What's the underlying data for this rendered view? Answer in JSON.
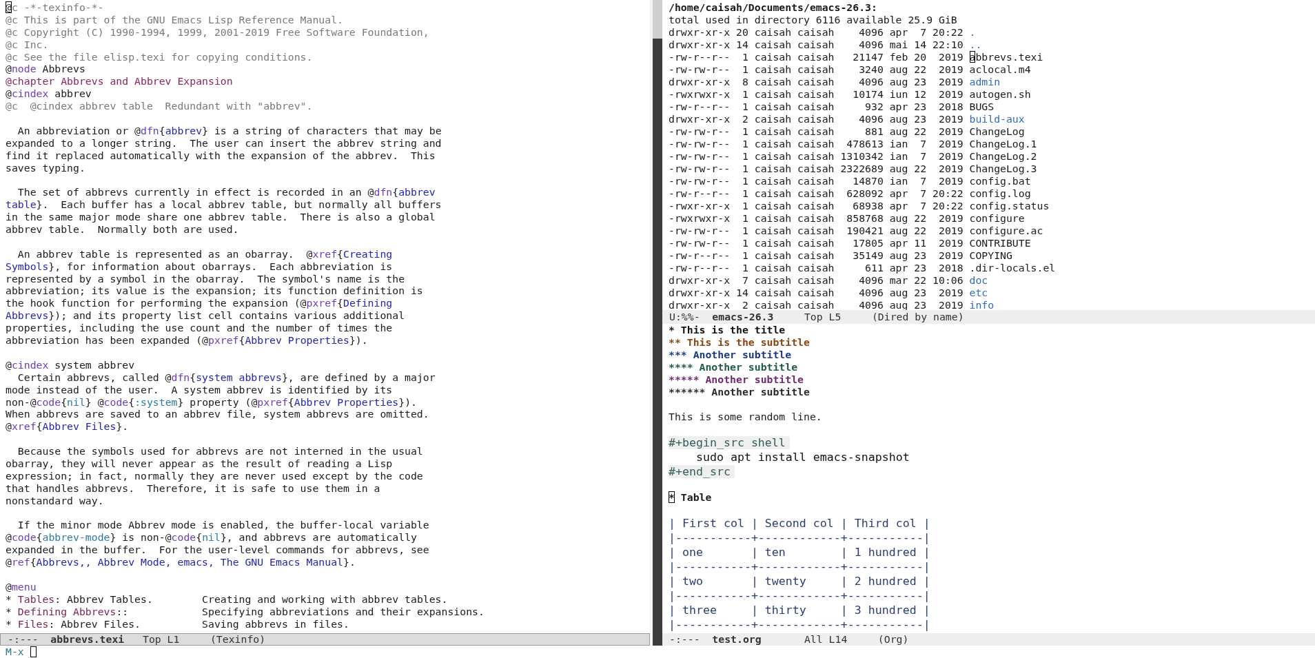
{
  "texinfo_window": {
    "paragraphs": [
      {
        "lines": [
          [
            {
              "kind": "cursor",
              "text": "@"
            },
            {
              "kind": "comment",
              "text": "c -*-texinfo-*-"
            }
          ],
          [
            {
              "kind": "comment",
              "text": "@c This is part of the GNU Emacs Lisp Reference Manual."
            }
          ],
          [
            {
              "kind": "comment",
              "text": "@c Copyright (C) 1990-1994, 1999, 2001-2019 Free Software Foundation,"
            }
          ],
          [
            {
              "kind": "comment",
              "text": "@c Inc."
            }
          ],
          [
            {
              "kind": "comment",
              "text": "@c See the file elisp.texi for copying conditions."
            }
          ],
          [
            {
              "kind": "plain",
              "text": "@"
            },
            {
              "kind": "keyword",
              "text": "node"
            },
            {
              "kind": "plain",
              "text": " Abbrevs"
            }
          ],
          [
            {
              "kind": "chapter",
              "text": "@chapter Abbrevs and Abbrev Expansion"
            }
          ],
          [
            {
              "kind": "plain",
              "text": "@"
            },
            {
              "kind": "keyword",
              "text": "cindex"
            },
            {
              "kind": "plain",
              "text": " abbrev"
            }
          ],
          [
            {
              "kind": "comment",
              "text": "@c  @cindex abbrev table  Redundant with \"abbrev\"."
            }
          ]
        ]
      },
      {
        "lines": [
          [
            {
              "kind": "plain",
              "text": "  An abbreviation or @"
            },
            {
              "kind": "keyword",
              "text": "dfn"
            },
            {
              "kind": "plain",
              "text": "{"
            },
            {
              "kind": "ref",
              "text": "abbrev"
            },
            {
              "kind": "plain",
              "text": "} is a string of characters that may be"
            }
          ],
          [
            {
              "kind": "plain",
              "text": "expanded to a longer string.  The user can insert the abbrev string and"
            }
          ],
          [
            {
              "kind": "plain",
              "text": "find it replaced automatically with the expansion of the abbrev.  This"
            }
          ],
          [
            {
              "kind": "plain",
              "text": "saves typing."
            }
          ]
        ]
      },
      {
        "lines": [
          [
            {
              "kind": "plain",
              "text": "  The set of abbrevs currently in effect is recorded in an @"
            },
            {
              "kind": "keyword",
              "text": "dfn"
            },
            {
              "kind": "plain",
              "text": "{"
            },
            {
              "kind": "ref",
              "text": "abbrev"
            }
          ],
          [
            {
              "kind": "ref",
              "text": "table"
            },
            {
              "kind": "plain",
              "text": "}.  Each buffer has a local abbrev table, but normally all buffers"
            }
          ],
          [
            {
              "kind": "plain",
              "text": "in the same major mode share one abbrev table.  There is also a global"
            }
          ],
          [
            {
              "kind": "plain",
              "text": "abbrev table.  Normally both are used."
            }
          ]
        ]
      },
      {
        "lines": [
          [
            {
              "kind": "plain",
              "text": "  An abbrev table is represented as an obarray.  @"
            },
            {
              "kind": "keyword",
              "text": "xref"
            },
            {
              "kind": "plain",
              "text": "{"
            },
            {
              "kind": "ref",
              "text": "Creating"
            }
          ],
          [
            {
              "kind": "ref",
              "text": "Symbols"
            },
            {
              "kind": "plain",
              "text": "}, for information about obarrays.  Each abbreviation is"
            }
          ],
          [
            {
              "kind": "plain",
              "text": "represented by a symbol in the obarray.  The symbol's name is the"
            }
          ],
          [
            {
              "kind": "plain",
              "text": "abbreviation; its value is the expansion; its function definition is"
            }
          ],
          [
            {
              "kind": "plain",
              "text": "the hook function for performing the expansion (@"
            },
            {
              "kind": "keyword",
              "text": "pxref"
            },
            {
              "kind": "plain",
              "text": "{"
            },
            {
              "kind": "ref",
              "text": "Defining"
            }
          ],
          [
            {
              "kind": "ref",
              "text": "Abbrevs"
            },
            {
              "kind": "plain",
              "text": "}); and its property list cell contains various additional"
            }
          ],
          [
            {
              "kind": "plain",
              "text": "properties, including the use count and the number of times the"
            }
          ],
          [
            {
              "kind": "plain",
              "text": "abbreviation has been expanded (@"
            },
            {
              "kind": "keyword",
              "text": "pxref"
            },
            {
              "kind": "plain",
              "text": "{"
            },
            {
              "kind": "ref",
              "text": "Abbrev Properties"
            },
            {
              "kind": "plain",
              "text": "})."
            }
          ]
        ]
      },
      {
        "lines": [
          [
            {
              "kind": "plain",
              "text": "@"
            },
            {
              "kind": "keyword",
              "text": "cindex"
            },
            {
              "kind": "plain",
              "text": " system abbrev"
            }
          ],
          [
            {
              "kind": "plain",
              "text": "  Certain abbrevs, called @"
            },
            {
              "kind": "keyword",
              "text": "dfn"
            },
            {
              "kind": "plain",
              "text": "{"
            },
            {
              "kind": "ref",
              "text": "system abbrevs"
            },
            {
              "kind": "plain",
              "text": "}, are defined by a major"
            }
          ],
          [
            {
              "kind": "plain",
              "text": "mode instead of the user.  A system abbrev is identified by its"
            }
          ],
          [
            {
              "kind": "plain",
              "text": "non-@"
            },
            {
              "kind": "keyword",
              "text": "code"
            },
            {
              "kind": "plain",
              "text": "{"
            },
            {
              "kind": "code",
              "text": "nil"
            },
            {
              "kind": "plain",
              "text": "} @"
            },
            {
              "kind": "keyword",
              "text": "code"
            },
            {
              "kind": "plain",
              "text": "{"
            },
            {
              "kind": "code",
              "text": ":system"
            },
            {
              "kind": "plain",
              "text": "} property (@"
            },
            {
              "kind": "keyword",
              "text": "pxref"
            },
            {
              "kind": "plain",
              "text": "{"
            },
            {
              "kind": "ref",
              "text": "Abbrev Properties"
            },
            {
              "kind": "plain",
              "text": "})."
            }
          ],
          [
            {
              "kind": "plain",
              "text": "When abbrevs are saved to an abbrev file, system abbrevs are omitted."
            }
          ],
          [
            {
              "kind": "plain",
              "text": "@"
            },
            {
              "kind": "keyword",
              "text": "xref"
            },
            {
              "kind": "plain",
              "text": "{"
            },
            {
              "kind": "ref",
              "text": "Abbrev Files"
            },
            {
              "kind": "plain",
              "text": "}."
            }
          ]
        ]
      },
      {
        "lines": [
          [
            {
              "kind": "plain",
              "text": "  Because the symbols used for abbrevs are not interned in the usual"
            }
          ],
          [
            {
              "kind": "plain",
              "text": "obarray, they will never appear as the result of reading a Lisp"
            }
          ],
          [
            {
              "kind": "plain",
              "text": "expression; in fact, normally they are never used except by the code"
            }
          ],
          [
            {
              "kind": "plain",
              "text": "that handles abbrevs.  Therefore, it is safe to use them in a"
            }
          ],
          [
            {
              "kind": "plain",
              "text": "nonstandard way."
            }
          ]
        ]
      },
      {
        "lines": [
          [
            {
              "kind": "plain",
              "text": "  If the minor mode Abbrev mode is enabled, the buffer-local variable"
            }
          ],
          [
            {
              "kind": "plain",
              "text": "@"
            },
            {
              "kind": "keyword",
              "text": "code"
            },
            {
              "kind": "plain",
              "text": "{"
            },
            {
              "kind": "code",
              "text": "abbrev-mode"
            },
            {
              "kind": "plain",
              "text": "} is non-@"
            },
            {
              "kind": "keyword",
              "text": "code"
            },
            {
              "kind": "plain",
              "text": "{"
            },
            {
              "kind": "code",
              "text": "nil"
            },
            {
              "kind": "plain",
              "text": "}, and abbrevs are automatically"
            }
          ],
          [
            {
              "kind": "plain",
              "text": "expanded in the buffer.  For the user-level commands for abbrevs, see"
            }
          ],
          [
            {
              "kind": "plain",
              "text": "@"
            },
            {
              "kind": "keyword",
              "text": "ref"
            },
            {
              "kind": "plain",
              "text": "{"
            },
            {
              "kind": "ref",
              "text": "Abbrevs,, Abbrev Mode, emacs, The GNU Emacs Manual"
            },
            {
              "kind": "plain",
              "text": "}."
            }
          ]
        ]
      },
      {
        "lines": [
          [
            {
              "kind": "plain",
              "text": "@"
            },
            {
              "kind": "keyword",
              "text": "menu"
            }
          ],
          [
            {
              "kind": "plain",
              "text": "* "
            },
            {
              "kind": "menu",
              "text": "Tables"
            },
            {
              "kind": "plain",
              "text": ": Abbrev Tables.        Creating and working with abbrev tables."
            }
          ],
          [
            {
              "kind": "plain",
              "text": "* "
            },
            {
              "kind": "menu",
              "text": "Defining Abbrevs"
            },
            {
              "kind": "plain",
              "text": "::            Specifying abbreviations and their expansions."
            }
          ],
          [
            {
              "kind": "plain",
              "text": "* "
            },
            {
              "kind": "menu",
              "text": "Files"
            },
            {
              "kind": "plain",
              "text": ": Abbrev Files.          Saving abbrevs in files."
            }
          ]
        ]
      }
    ],
    "mode_line": {
      "status": "-:---",
      "buffer": "abbrevs.texi",
      "position": "Top L1",
      "mode": "(Texinfo)",
      "active": true
    }
  },
  "dired_window": {
    "header": "/home/caisah/Documents/emacs-26.3:",
    "summary": "total used in directory 6116 available 25.9 GiB",
    "rows": [
      {
        "info": "drwxr-xr-x 20 caisah caisah    4096 apr  7 20:22",
        "name": ".",
        "kind": "dir",
        "cursor": false
      },
      {
        "info": "drwxr-xr-x 14 caisah caisah    4096 mai 14 22:10",
        "name": "..",
        "kind": "dir",
        "cursor": false
      },
      {
        "info": "-rw-r--r--  1 caisah caisah   21147 feb 20  2019",
        "name": "abbrevs.texi",
        "kind": "file",
        "cursor": true
      },
      {
        "info": "-rw-rw-r--  1 caisah caisah    3240 aug 22  2019",
        "name": "aclocal.m4",
        "kind": "file",
        "cursor": false
      },
      {
        "info": "drwxr-xr-x  8 caisah caisah    4096 aug 23  2019",
        "name": "admin",
        "kind": "dir",
        "cursor": false
      },
      {
        "info": "-rwxrwxr-x  1 caisah caisah   10174 iun 12  2019",
        "name": "autogen.sh",
        "kind": "file",
        "cursor": false
      },
      {
        "info": "-rw-r--r--  1 caisah caisah     932 apr 23  2018",
        "name": "BUGS",
        "kind": "file",
        "cursor": false
      },
      {
        "info": "drwxr-xr-x  2 caisah caisah    4096 aug 23  2019",
        "name": "build-aux",
        "kind": "dir",
        "cursor": false
      },
      {
        "info": "-rw-rw-r--  1 caisah caisah     881 aug 22  2019",
        "name": "ChangeLog",
        "kind": "file",
        "cursor": false
      },
      {
        "info": "-rw-rw-r--  1 caisah caisah  478613 ian  7  2019",
        "name": "ChangeLog.1",
        "kind": "file",
        "cursor": false
      },
      {
        "info": "-rw-rw-r--  1 caisah caisah 1310342 ian  7  2019",
        "name": "ChangeLog.2",
        "kind": "file",
        "cursor": false
      },
      {
        "info": "-rw-rw-r--  1 caisah caisah 2322689 aug 22  2019",
        "name": "ChangeLog.3",
        "kind": "file",
        "cursor": false
      },
      {
        "info": "-rw-rw-r--  1 caisah caisah   14870 ian  7  2019",
        "name": "config.bat",
        "kind": "file",
        "cursor": false
      },
      {
        "info": "-rw-r--r--  1 caisah caisah  628092 apr  7 20:22",
        "name": "config.log",
        "kind": "file",
        "cursor": false
      },
      {
        "info": "-rwxr-xr-x  1 caisah caisah   68938 apr  7 20:22",
        "name": "config.status",
        "kind": "file",
        "cursor": false
      },
      {
        "info": "-rwxrwxr-x  1 caisah caisah  858768 aug 22  2019",
        "name": "configure",
        "kind": "file",
        "cursor": false
      },
      {
        "info": "-rw-rw-r--  1 caisah caisah  190421 aug 22  2019",
        "name": "configure.ac",
        "kind": "file",
        "cursor": false
      },
      {
        "info": "-rw-rw-r--  1 caisah caisah   17805 apr 11  2019",
        "name": "CONTRIBUTE",
        "kind": "file",
        "cursor": false
      },
      {
        "info": "-rw-r--r--  1 caisah caisah   35149 aug 23  2019",
        "name": "COPYING",
        "kind": "file",
        "cursor": false
      },
      {
        "info": "-rw-r--r--  1 caisah caisah     611 apr 23  2018",
        "name": ".dir-locals.el",
        "kind": "file",
        "cursor": false
      },
      {
        "info": "drwxr-xr-x  7 caisah caisah    4096 mar 22 10:06",
        "name": "doc",
        "kind": "dir",
        "cursor": false
      },
      {
        "info": "drwxr-xr-x 14 caisah caisah    4096 aug 23  2019",
        "name": "etc",
        "kind": "dir",
        "cursor": false
      },
      {
        "info": "drwxr-xr-x  2 caisah caisah    4096 aug 23  2019",
        "name": "info",
        "kind": "dir",
        "cursor": false
      }
    ],
    "mode_line": {
      "status": "U:%%-",
      "buffer": "emacs-26.3",
      "position": "Top L5",
      "mode": "(Dired by name)",
      "active": false
    }
  },
  "org_window": {
    "blocks": [
      {
        "kind": "outline",
        "items": [
          {
            "stars": "*",
            "text": "This is the title",
            "children": [
              {
                "stars": "**",
                "text": "This is the subtitle",
                "children": [
                  {
                    "stars": "***",
                    "text": "Another subtitle",
                    "children": [
                      {
                        "stars": "****",
                        "text": "Another subtitle",
                        "children": [
                          {
                            "stars": "*****",
                            "text": "Another subtitle",
                            "children": [
                              {
                                "stars": "******",
                                "text": "Another subtitle"
                              }
                            ]
                          }
                        ]
                      }
                    ]
                  }
                ]
              }
            ]
          }
        ]
      },
      {
        "kind": "text",
        "text": "This is some random line."
      },
      {
        "kind": "src",
        "begin": "#+begin_src shell",
        "body": "    sudo apt install emacs-snapshot",
        "end": "#+end_src"
      },
      {
        "kind": "heading",
        "stars": "*",
        "text": "Table",
        "cursor": true
      },
      {
        "kind": "table",
        "lines": [
          "| First col | Second col | Third col |",
          "|-----------+------------+-----------|",
          "| one       | ten        | 1 hundred |",
          "|-----------+------------+-----------|",
          "| two       | twenty     | 2 hundred |",
          "|-----------+------------+-----------|",
          "| three     | thirty     | 3 hundred |",
          "|-----------+------------+-----------|"
        ]
      }
    ],
    "mode_line": {
      "status": "-:---",
      "buffer": "test.org",
      "position": "All L14",
      "mode": "(Org)",
      "active": false
    }
  },
  "minibuffer": {
    "prompt": "M-x",
    "cursor": true
  }
}
